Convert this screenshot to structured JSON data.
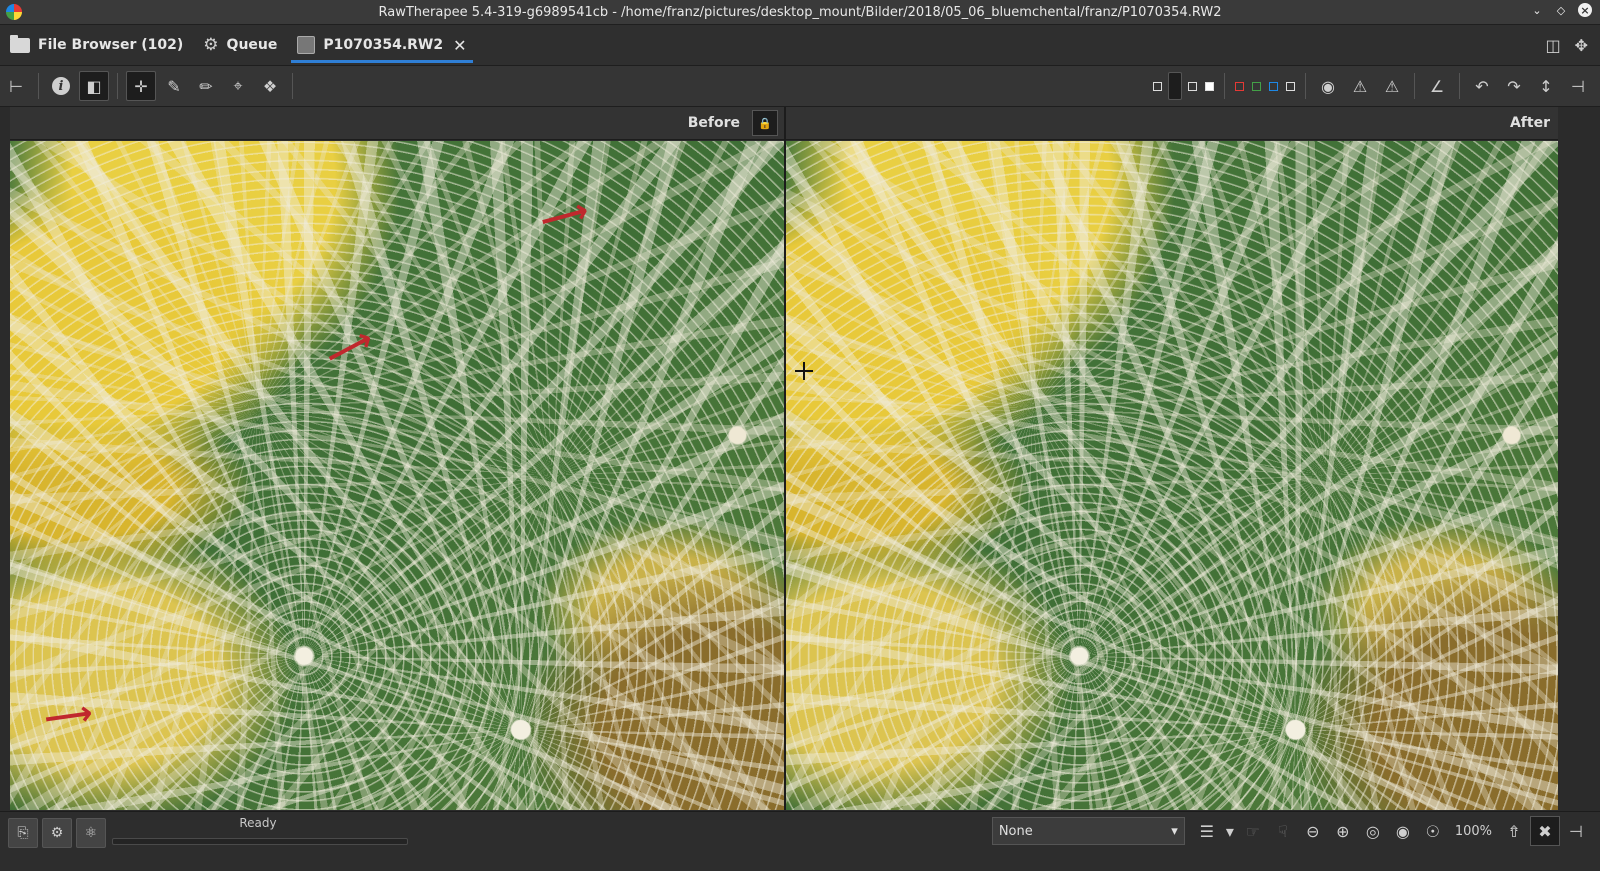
{
  "window": {
    "title": "RawTherapee 5.4-319-g6989541cb - /home/franz/pictures/desktop_mount/Bilder/2018/05_06_bluemchental/franz/P1070354.RW2"
  },
  "tabs": [
    {
      "label": "File Browser (102)",
      "icon": "folder-icon"
    },
    {
      "label": "Queue",
      "icon": "gears-icon"
    },
    {
      "label": "P1070354.RW2",
      "icon": "image-thumbnail-icon",
      "active": true
    }
  ],
  "views": {
    "before_label": "Before",
    "after_label": "After"
  },
  "status": {
    "text": "Ready",
    "progress": 0
  },
  "bottom_toolbar": {
    "profile_select_value": "None",
    "zoom_label": "100%"
  },
  "colors": {
    "accent": "#2f7fd6",
    "annotation_arrow": "#c0282d"
  }
}
